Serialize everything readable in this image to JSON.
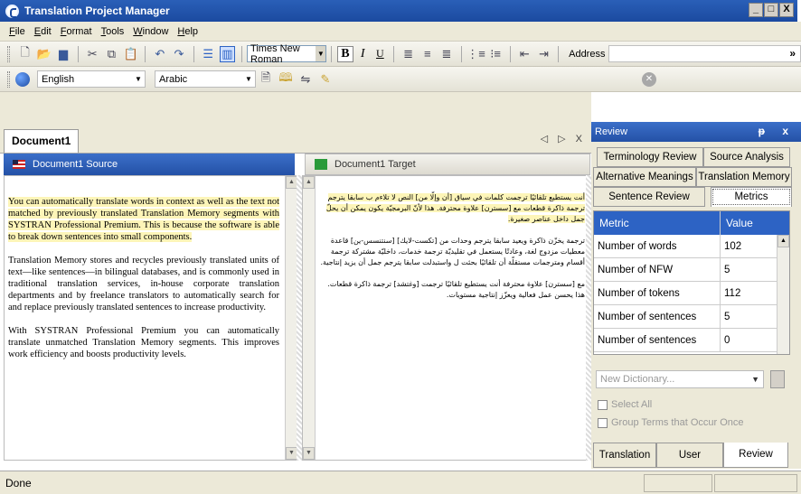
{
  "window": {
    "title": "Translation Project Manager",
    "buttons": [
      "_",
      "□",
      "X"
    ]
  },
  "menu": [
    "File",
    "Edit",
    "Format",
    "Tools",
    "Window",
    "Help"
  ],
  "toolbar": {
    "font": "Times New Roman",
    "bold": "B",
    "italic": "I",
    "underline": "U",
    "address_label": "Address",
    "overflow": "»"
  },
  "languages": {
    "source": "English",
    "target": "Arabic"
  },
  "document": {
    "tab": "Document1",
    "nav": "◁ ▷ X",
    "source_title": "Document1 Source",
    "target_title": "Document1 Target",
    "source_paragraphs": [
      "You can automatically translate words in context as well as the text not matched by previously translated Translation Memory segments with SYSTRAN Professional Premium. This is because the software is able to break down sentences into small components.",
      "Translation Memory stores and recycles previously translated units of text—like sentences—in bilingual databases, and is commonly used in traditional translation services, in-house corporate translation departments and by freelance translators to automatically search for and replace previously translated sentences to increase productivity.",
      "With SYSTRAN Professional Premium you can automatically translate unmatched Translation Memory segments. This improves work efficiency and boosts productivity levels."
    ],
    "target_paragraphs": [
      "أنت يستطيع تلقائيًا ترجمت كلمات في سياق [أن وإلّا من] النص لا تلاءم ب سابقا يترجم ترجمة ذاكرة قطعات مع [سسترن] علاوة محترفة. هذا لأنّ البرمجيّة يكون يمكن أن يحلّ جمل داخل عناصر صغيرة.",
      "ترجمة يخزّن ذاكرة ويعيد سابقا يترجم وحدات من [تكست-لايك] [سنتنسس-ين] قاعدة معطيات مزدوج لغة، وعادتًا يستعمل في تقليديّة ترجمة خدمات، داخليّة مشتركة ترجمة أقسام ومترجمات مستقلّة أن تلقائيًا بحثت ل واستبدلت سابقا يترجم جمل أن يزيد إنتاجية.",
      "مع [سسترن] علاوة محترفة أنت يستطيع تلقائيًا ترجمت [وغتشد] ترجمة ذاكرة قطعات. هذا يحسن عمل فعالية ويعزّز إنتاجية مستويات."
    ]
  },
  "review": {
    "title": "Review",
    "header_buttons": "ᵽ x",
    "tabs_row1": [
      "Terminology Review",
      "Source Analysis"
    ],
    "tabs_row2": [
      "Alternative Meanings",
      "Translation Memory"
    ],
    "tabs_row3": [
      "Sentence Review",
      "Metrics"
    ],
    "metrics_header": [
      "Metric",
      "Value"
    ],
    "metrics": [
      {
        "metric": "Number of words",
        "value": "102"
      },
      {
        "metric": "Number of NFW",
        "value": "5"
      },
      {
        "metric": "Number of tokens",
        "value": "112"
      },
      {
        "metric": "Number of sentences",
        "value": "5"
      },
      {
        "metric": "Number of sentences matched",
        "value": "0"
      }
    ],
    "dictionary_placeholder": "New Dictionary...",
    "select_all": "Select All",
    "group_terms": "Group Terms that Occur Once",
    "bottom_tabs": [
      "Translation ...",
      "User Diction...",
      "Review"
    ]
  },
  "status": {
    "text": "Done"
  },
  "colors": {
    "title_bar": "#1b4aa0",
    "accent_blue": "#2d63c4",
    "highlight": "#fdf5b8",
    "chrome": "#ece9d8"
  }
}
